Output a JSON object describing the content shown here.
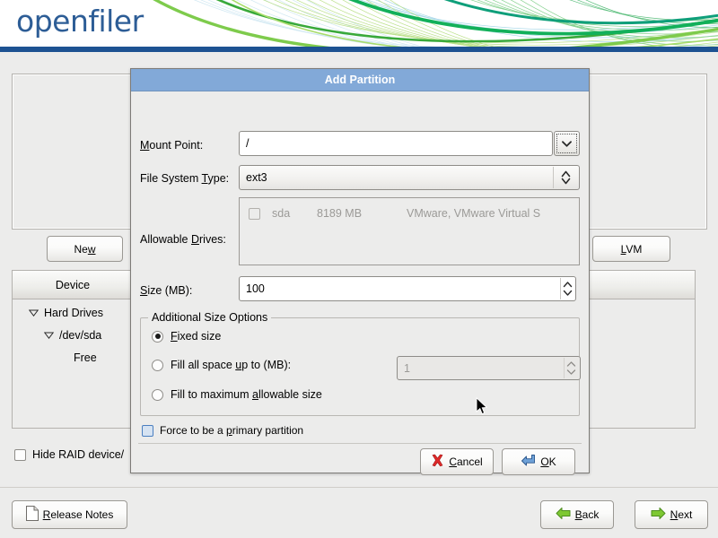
{
  "header": {
    "logo_text": "openfiler",
    "logo_color": "#2d5d96",
    "bar_color": "#1d5292"
  },
  "background": {
    "new_button": "New",
    "lvm_button": "LVM",
    "tree_columns": [
      "Device"
    ],
    "tree_rows": [
      {
        "label": "Hard Drives",
        "indent": 0,
        "expander": "expanded"
      },
      {
        "label": "/dev/sda",
        "indent": 1,
        "expander": "expanded"
      },
      {
        "label": "Free",
        "indent": 2,
        "expander": "none"
      }
    ],
    "hide_raid_label": "Hide RAID device/",
    "hide_raid_checked": false
  },
  "footer": {
    "release_notes": "Release Notes",
    "back": "Back",
    "next": "Next"
  },
  "dialog": {
    "title": "Add Partition",
    "title_bg": "#82a9d8",
    "mount_point": {
      "label_pre": "M",
      "label_post": "ount Point:",
      "value": "/",
      "dropdown_icon": "chevron-down-icon"
    },
    "file_system_type": {
      "label_pre": "File System ",
      "label_mid": "T",
      "label_post": "ype:",
      "value": "ext3",
      "spinner_icon": "up-down-arrows-icon"
    },
    "allowable_drives": {
      "label_pre": "Allowable ",
      "label_mid": "D",
      "label_post": "rives:",
      "rows": [
        {
          "checked": false,
          "device": "sda",
          "size": "8189 MB",
          "model": "VMware, VMware Virtual S",
          "enabled": false
        }
      ]
    },
    "size": {
      "label_pre": "S",
      "label_post": "ize (MB):",
      "value": "100"
    },
    "additional_size_options": {
      "legend": "Additional Size Options",
      "options": [
        {
          "label_pre": "F",
          "label_post": "ixed size",
          "selected": true
        },
        {
          "label_pre": "Fill all space ",
          "label_mid": "u",
          "label_post": "p to (MB):",
          "selected": false
        },
        {
          "label_pre": "Fill to maximum ",
          "label_mid": "a",
          "label_post": "llowable size",
          "selected": false
        }
      ],
      "fill_up_to_value": "1",
      "fill_up_to_enabled": false
    },
    "force_primary": {
      "label_pre": "Force to be a ",
      "label_mid": "p",
      "label_post": "rimary partition",
      "checked": false
    },
    "cancel_button": {
      "label_pre": "C",
      "label_post": "ancel",
      "icon": "red-x-icon"
    },
    "ok_button": {
      "label_pre": "O",
      "label_post": "K",
      "icon": "enter-arrow-icon"
    }
  }
}
